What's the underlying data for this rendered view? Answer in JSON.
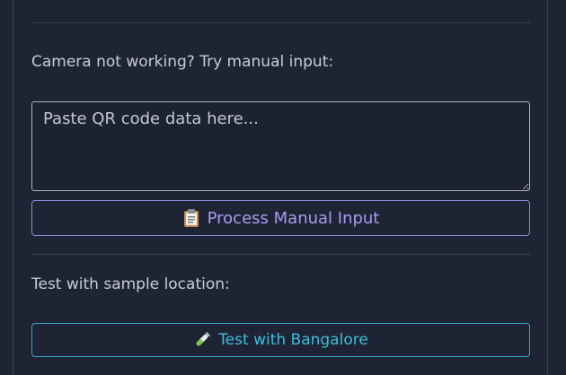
{
  "manual_section": {
    "prompt": "Camera not working? Try manual input:",
    "textarea_placeholder": "Paste QR code data here...",
    "textarea_value": "",
    "process_button_label": "Process Manual Input",
    "process_button_icon": "clipboard-icon"
  },
  "sample_section": {
    "prompt": "Test with sample location:",
    "test_button_label": "Test with Bangalore",
    "test_button_icon": "test-tube-icon"
  },
  "colors": {
    "background": "#1e2433",
    "process_accent": "#a79cf2",
    "test_accent": "#3cbde0"
  }
}
